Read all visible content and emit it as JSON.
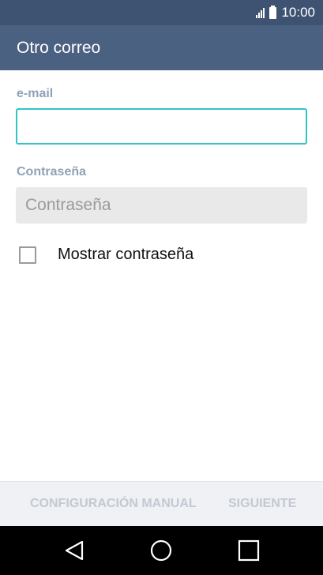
{
  "status_bar": {
    "time": "10:00",
    "icons": [
      "signal-icon",
      "battery-icon"
    ]
  },
  "app_bar": {
    "title": "Otro correo"
  },
  "form": {
    "email": {
      "label": "e-mail",
      "value": "",
      "placeholder": ""
    },
    "password": {
      "label": "Contraseña",
      "value": "",
      "placeholder": "Contraseña"
    },
    "show_password": {
      "label": "Mostrar contraseña",
      "checked": false
    }
  },
  "footer": {
    "manual_label": "CONFIGURACIÓN MANUAL",
    "next_label": "SIGUIENTE"
  },
  "nav_bar": {
    "icons": [
      "back-icon",
      "home-icon",
      "recents-icon"
    ]
  },
  "colors": {
    "status_bar": "#3e5372",
    "app_bar": "#4b6182",
    "field_focus_border": "#33c4c6",
    "label": "#8fa2b6",
    "disabled_button": "#c3c9d2"
  }
}
